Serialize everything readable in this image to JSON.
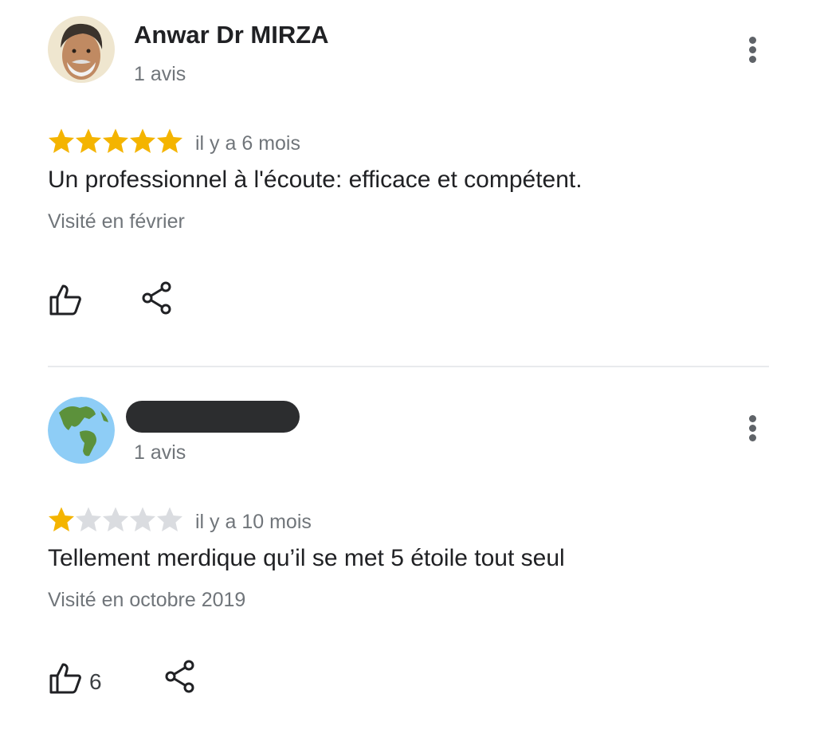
{
  "reviews": [
    {
      "author": "Anwar Dr MIRZA",
      "review_count": "1 avis",
      "rating": 5,
      "max_rating": 5,
      "date": "il y a 6 mois",
      "text": "Un professionnel à l'écoute: efficace et compétent.",
      "visited": "Visité en février",
      "likes": "",
      "avatar_icon": "person-photo-avatar"
    },
    {
      "author": "",
      "review_count": "1 avis",
      "rating": 1,
      "max_rating": 5,
      "date": "il y a 10 mois",
      "text": "Tellement merdique qu’il se met 5 étoile tout seul",
      "visited": "Visité en octobre 2019",
      "likes": "6",
      "avatar_icon": "globe-americas-icon"
    }
  ],
  "colors": {
    "star_filled": "#f4b400",
    "star_empty": "#dadce0",
    "text_primary": "#202124",
    "text_secondary": "#70757a",
    "divider": "#e8eaed"
  }
}
